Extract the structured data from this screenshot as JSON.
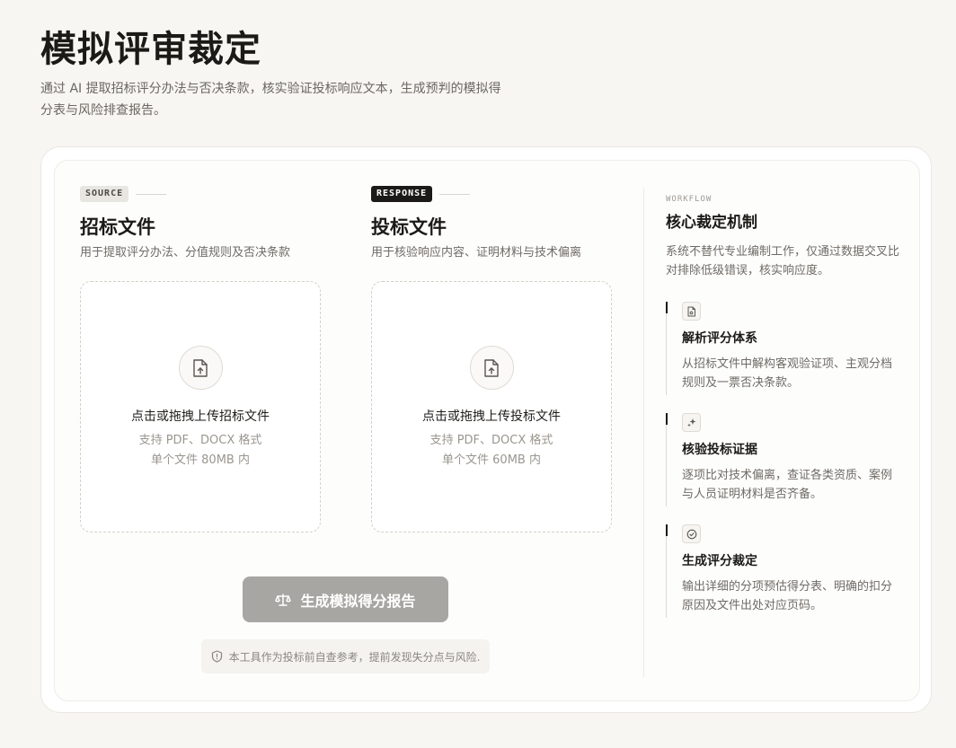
{
  "header": {
    "title": "模拟评审裁定",
    "description": "通过 AI 提取招标评分办法与否决条款，核实验证投标响应文本，生成预判的模拟得分表与风险排查报告。"
  },
  "source": {
    "tag": "SOURCE",
    "title": "招标文件",
    "subtitle": "用于提取评分办法、分值规则及否决条款",
    "dropzone": {
      "main": "点击或拖拽上传招标文件",
      "formats": "支持 PDF、DOCX 格式",
      "limit": "单个文件 80MB 内"
    }
  },
  "response": {
    "tag": "RESPONSE",
    "title": "投标文件",
    "subtitle": "用于核验响应内容、证明材料与技术偏离",
    "dropzone": {
      "main": "点击或拖拽上传投标文件",
      "formats": "支持 PDF、DOCX 格式",
      "limit": "单个文件 60MB 内"
    }
  },
  "actions": {
    "generate_label": "生成模拟得分报告",
    "disclaimer": "本工具作为投标前自查参考，提前发现失分点与风险."
  },
  "workflow": {
    "label": "WORKFLOW",
    "title": "核心裁定机制",
    "description": "系统不替代专业编制工作，仅通过数据交叉比对排除低级错误，核实响应度。",
    "steps": [
      {
        "icon": "document-icon",
        "title": "解析评分体系",
        "desc": "从招标文件中解构客观验证项、主观分档规则及一票否决条款。"
      },
      {
        "icon": "sparkle-icon",
        "title": "核验投标证据",
        "desc": "逐项比对技术偏离，查证各类资质、案例与人员证明材料是否齐备。"
      },
      {
        "icon": "check-circle-icon",
        "title": "生成评分裁定",
        "desc": "输出详细的分项预估得分表、明确的扣分原因及文件出处对应页码。"
      }
    ]
  },
  "colors": {
    "background": "#f7f6f3",
    "button_disabled": "#a8a6a2",
    "text_primary": "#1c1a17",
    "text_muted": "#6f6b65"
  }
}
